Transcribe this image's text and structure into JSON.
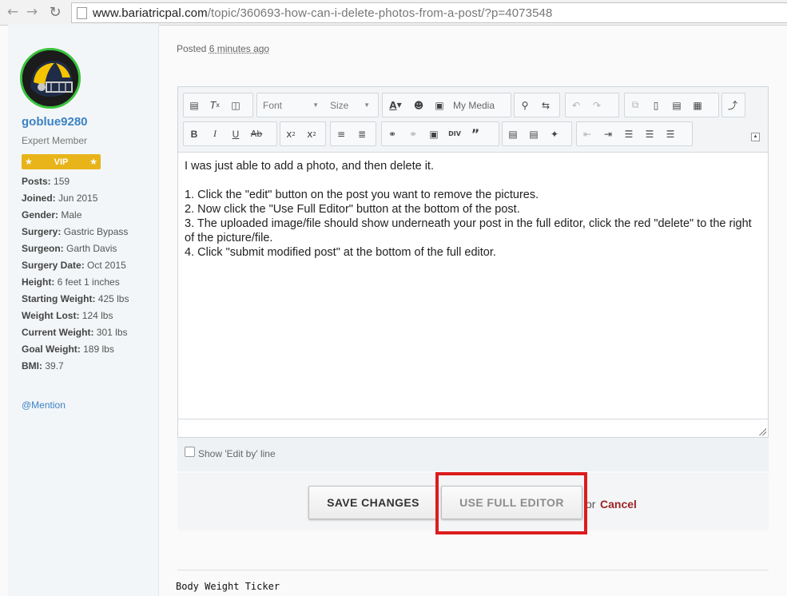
{
  "browser": {
    "back_icon": "back-arrow-icon",
    "forward_icon": "forward-arrow-icon",
    "reload_icon": "reload-icon",
    "url_host": "www.bariatricpal.com",
    "url_path": "/topic/360693-how-can-i-delete-photos-from-a-post/?p=4073548"
  },
  "user": {
    "username": "goblue9280",
    "title": "Expert Member",
    "badge": "VIP",
    "stats": [
      {
        "label": "Posts:",
        "value": "159"
      },
      {
        "label": "Joined:",
        "value": "Jun 2015"
      },
      {
        "label": "Gender:",
        "value": "Male"
      },
      {
        "label": "Surgery:",
        "value": "Gastric Bypass"
      },
      {
        "label": "Surgeon:",
        "value": "Garth Davis"
      },
      {
        "label": "Surgery Date:",
        "value": "Oct 2015"
      },
      {
        "label": "Height:",
        "value": "6 feet 1 inches"
      },
      {
        "label": "Starting Weight:",
        "value": "425 lbs"
      },
      {
        "label": "Weight Lost:",
        "value": "124 lbs"
      },
      {
        "label": "Current Weight:",
        "value": "301 lbs"
      },
      {
        "label": "Goal Weight:",
        "value": "189 lbs"
      },
      {
        "label": "BMI:",
        "value": "39.7"
      }
    ],
    "mention": "@Mention"
  },
  "post": {
    "posted_label": "Posted",
    "posted_ago": "6 minutes ago"
  },
  "editor": {
    "font_select": "Font",
    "size_select": "Size",
    "my_media": "My Media",
    "body_lines": [
      "I was just able to add a photo, and then delete it.",
      "",
      "1.  Click the \"edit\" button on the post you want to remove the pictures.",
      "2.  Now click the \"Use Full Editor\" button at the bottom of the post.",
      "3.  The uploaded image/file should show underneath your post in the full editor, click the red \"delete\" to the right of the picture/file.",
      "4.  Click \"submit modified post\" at the bottom of the full editor."
    ],
    "show_edit_by": "Show 'Edit by' line"
  },
  "actions": {
    "save": "SAVE CHANGES",
    "full_editor": "USE FULL EDITOR",
    "or": "or",
    "cancel": "Cancel"
  },
  "footer": {
    "ticker": "Body Weight Ticker"
  },
  "colors": {
    "accent_blue": "#3b82c4",
    "vip_gold": "#e8b419",
    "avatar_ring": "#39c23d",
    "cancel_red": "#9e2424",
    "highlight_red": "#dc1d1d"
  }
}
